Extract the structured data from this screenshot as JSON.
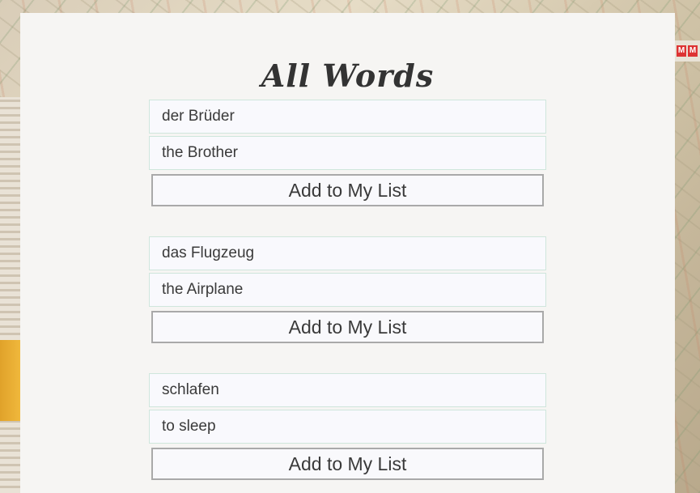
{
  "page": {
    "title": "All Words"
  },
  "words": [
    {
      "german": "der Brüder",
      "english": "the Brother",
      "button_label": "Add to My List"
    },
    {
      "german": "das Flugzeug",
      "english": "the Airplane",
      "button_label": "Add to My List"
    },
    {
      "german": "schlafen",
      "english": "to sleep",
      "button_label": "Add to My List"
    }
  ],
  "colors": {
    "panel_background": "#f6f5f3",
    "field_background": "#f9f9fd",
    "field_border": "#cfe6dc",
    "button_border": "#a9a9a9",
    "text": "#3a3a3a"
  }
}
